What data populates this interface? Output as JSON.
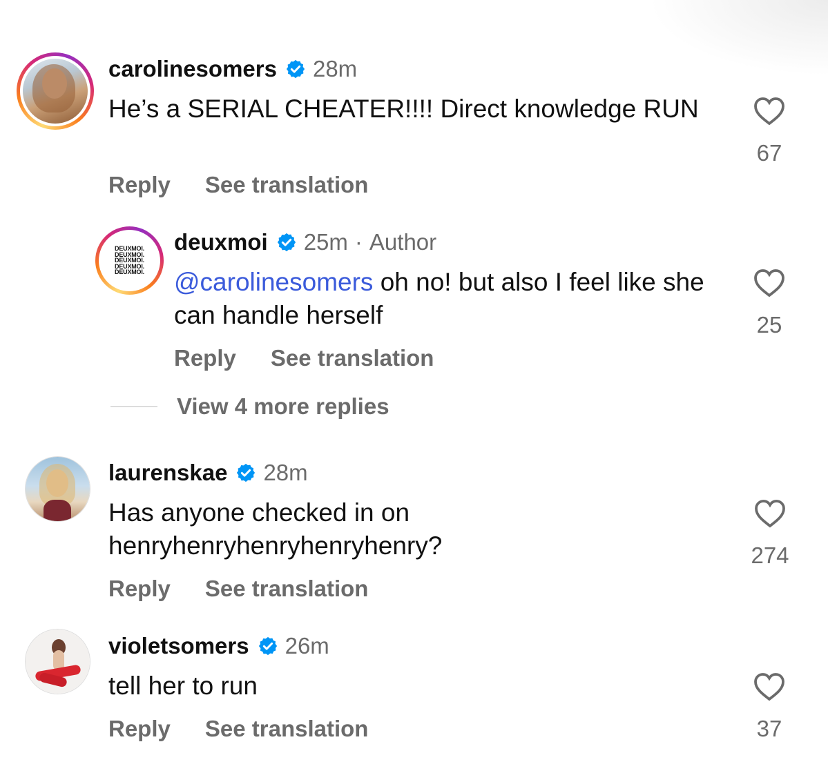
{
  "comments": [
    {
      "username": "carolinesomers",
      "time": "28m",
      "text": "He’s a SERIAL CHEATER!!!! Direct knowledge RUN",
      "reply_label": "Reply",
      "translate_label": "See translation",
      "likes": "67",
      "avatar_icon": "profile-photo"
    },
    {
      "username": "deuxmoi",
      "time": "25m",
      "separator": "·",
      "badge": "Author",
      "mention": "@carolinesomers",
      "text": " oh no! but also I feel like she can handle herself",
      "reply_label": "Reply",
      "translate_label": "See translation",
      "likes": "25",
      "logo_lines": [
        "DEUXMOI.",
        "DEUXMOI.",
        "DEUXMOI.",
        "DEUXMOI.",
        "DEUXMOI."
      ]
    },
    {
      "username": "laurenskae",
      "time": "28m",
      "text": "Has anyone checked in on henryhenryhenryhenryhenry?",
      "reply_label": "Reply",
      "translate_label": "See translation",
      "likes": "274",
      "avatar_icon": "profile-photo"
    },
    {
      "username": "violetsomers",
      "time": "26m",
      "text": "tell her to run",
      "reply_label": "Reply",
      "translate_label": "See translation",
      "likes": "37",
      "avatar_icon": "profile-photo"
    }
  ],
  "more_replies": "View 4 more replies",
  "colors": {
    "verified": "#0095f6",
    "mention": "#3b5bdb",
    "secondary_text": "#6b6b6b"
  }
}
